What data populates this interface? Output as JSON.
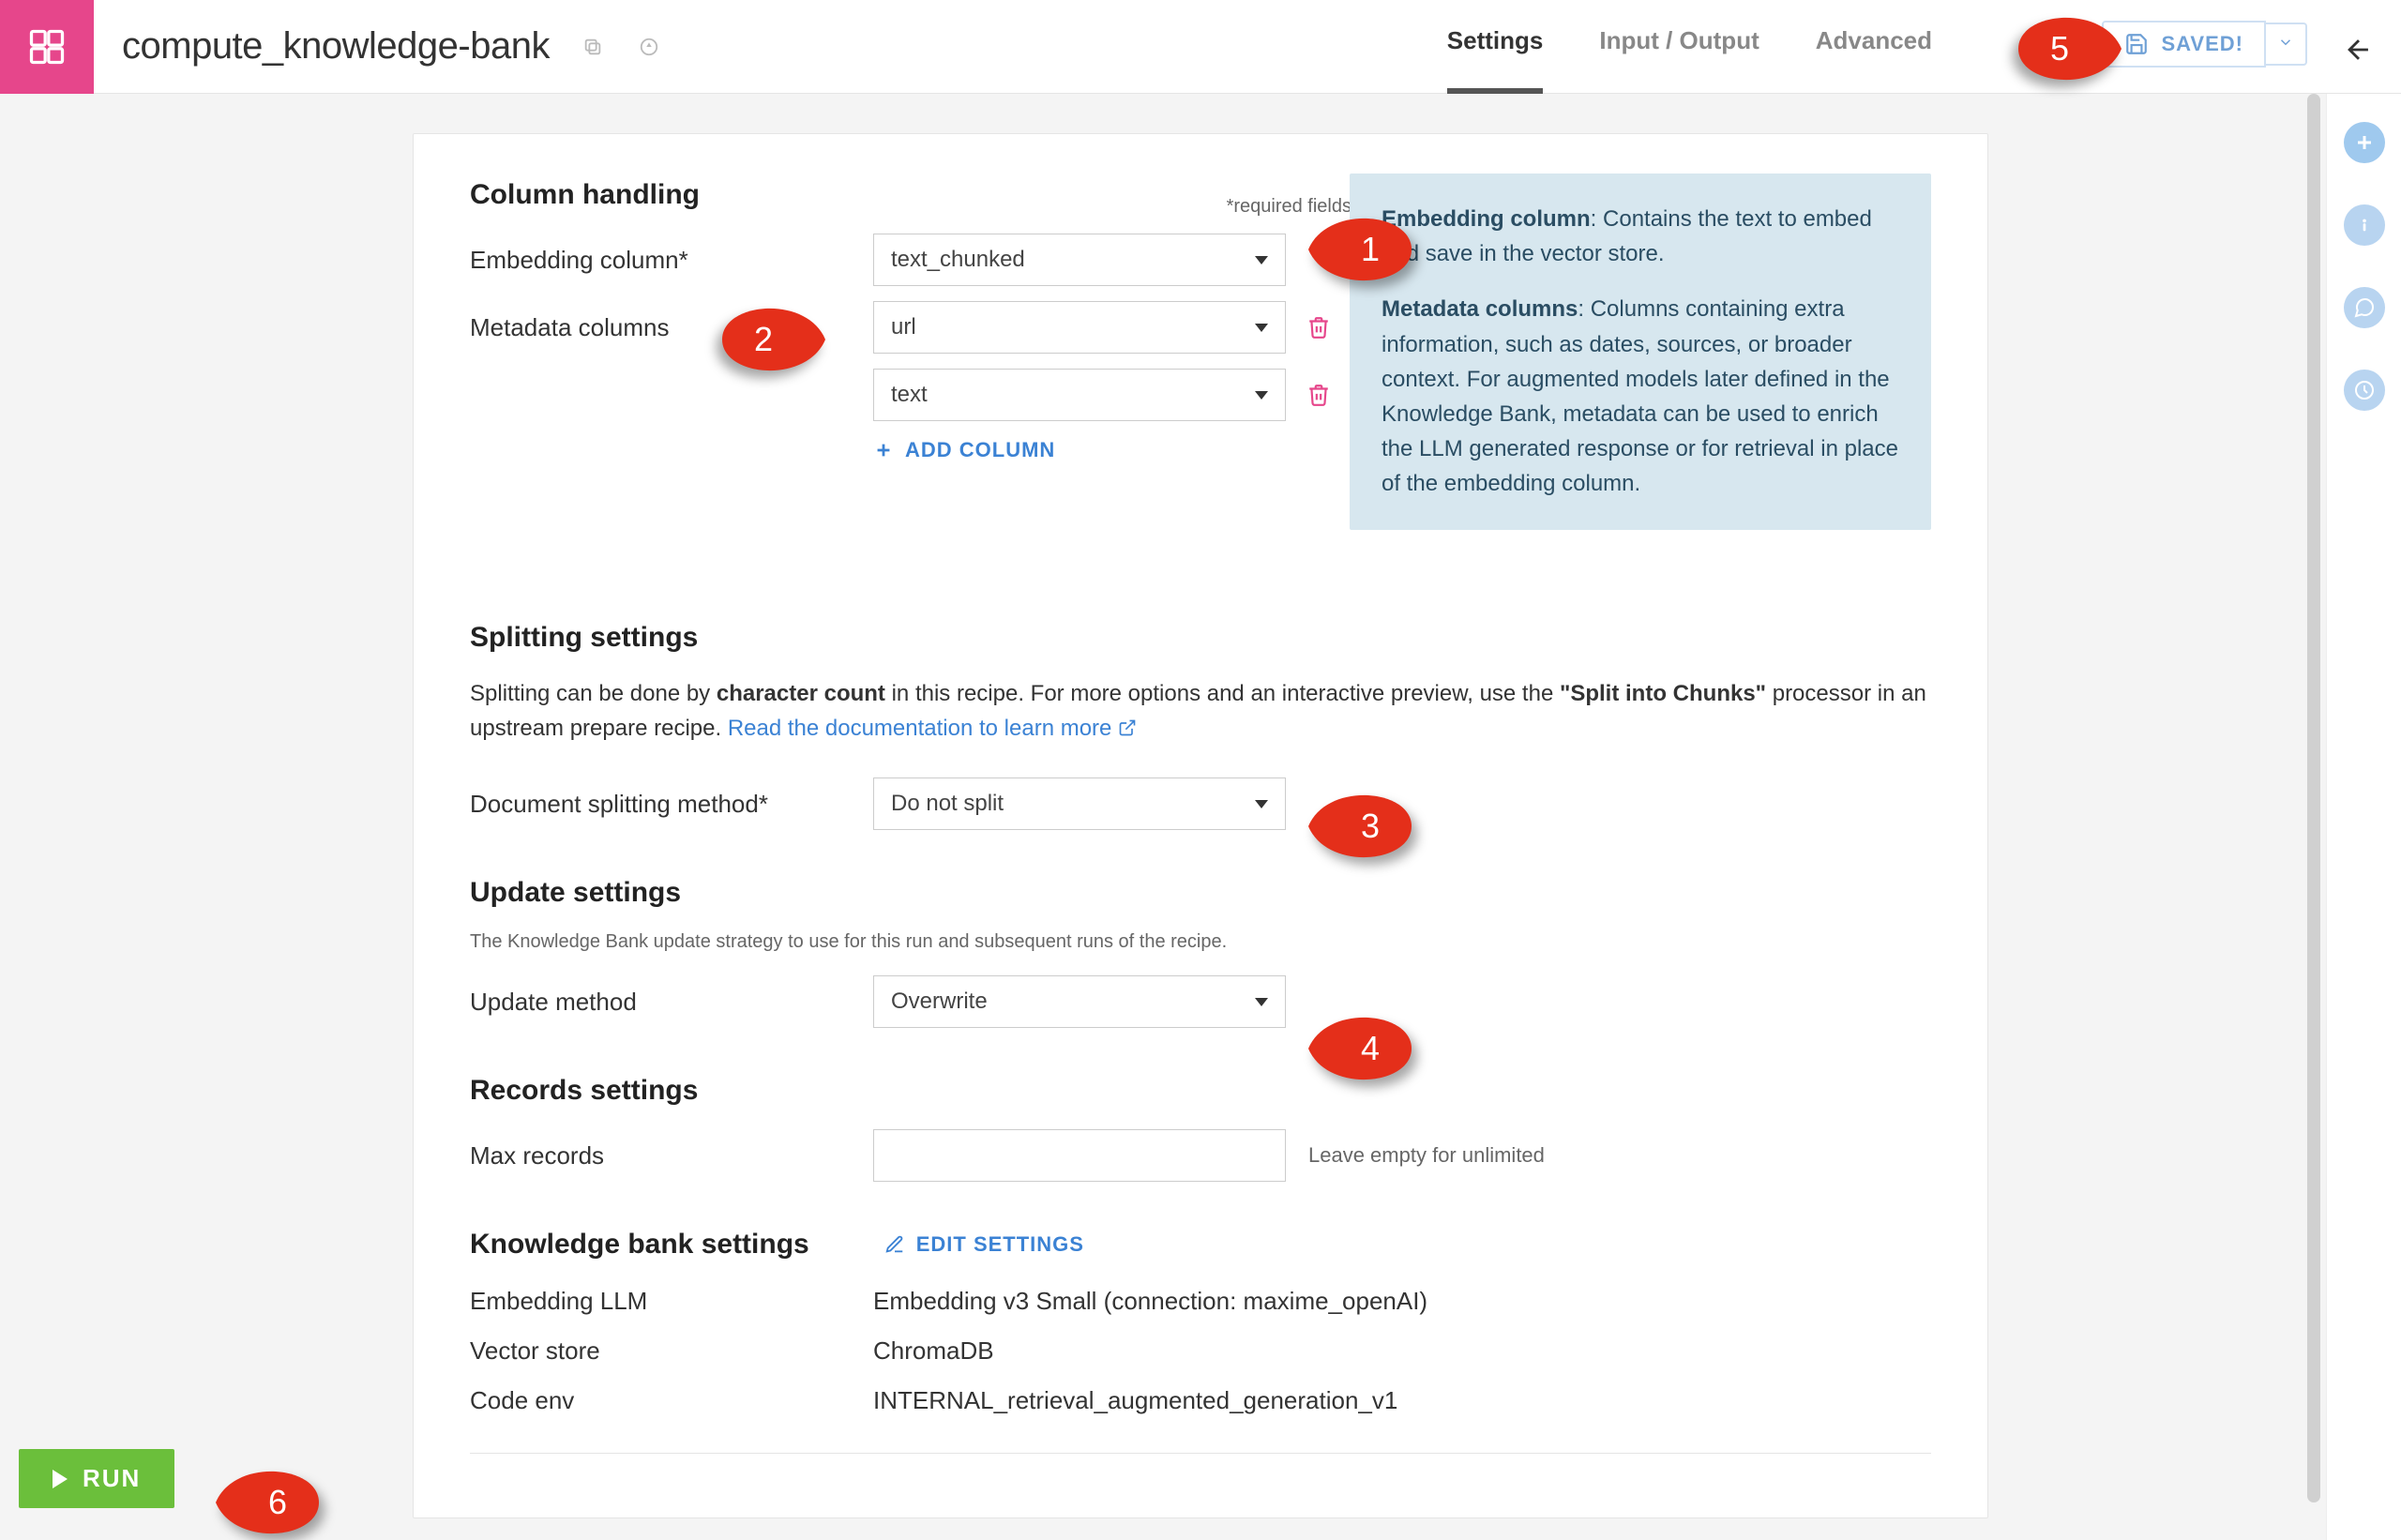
{
  "header": {
    "title": "compute_knowledge-bank",
    "tabs": {
      "settings": "Settings",
      "io": "Input / Output",
      "advanced": "Advanced"
    },
    "saved_label": "SAVED!"
  },
  "column_handling": {
    "heading": "Column handling",
    "required_note": "*required fields",
    "embedding_label": "Embedding column*",
    "embedding_value": "text_chunked",
    "metadata_label": "Metadata columns",
    "metadata_values": [
      "url",
      "text"
    ],
    "add_column": "ADD COLUMN"
  },
  "info_box": {
    "p1a": "Embedding column",
    "p1b": ": Contains the text to embed and save in the vector store.",
    "p2a": "Metadata columns",
    "p2b": ": Columns containing extra information, such as dates, sources, or broader context. For augmented models later defined in the Knowledge Bank, metadata can be used to enrich the LLM generated response or for retrieval in place of the embedding column."
  },
  "splitting": {
    "heading": "Splitting settings",
    "desc_prefix": "Splitting can be done by ",
    "desc_bold1": "character count",
    "desc_mid": " in this recipe. For more options and an interactive preview, use the ",
    "desc_bold2": "\"Split into Chunks\"",
    "desc_suffix": " processor in an upstream prepare recipe. ",
    "doc_link": "Read the documentation to learn more",
    "method_label": "Document splitting method*",
    "method_value": "Do not split"
  },
  "update": {
    "heading": "Update settings",
    "micro": "The Knowledge Bank update strategy to use for this run and subsequent runs of the recipe.",
    "method_label": "Update method",
    "method_value": "Overwrite"
  },
  "records": {
    "heading": "Records settings",
    "label": "Max records",
    "hint": "Leave empty for unlimited",
    "value": ""
  },
  "kb": {
    "heading": "Knowledge bank settings",
    "edit": "EDIT SETTINGS",
    "rows": {
      "llm_label": "Embedding LLM",
      "llm_value": "Embedding v3 Small (connection: maxime_openAI)",
      "vs_label": "Vector store",
      "vs_value": "ChromaDB",
      "env_label": "Code env",
      "env_value": "INTERNAL_retrieval_augmented_generation_v1"
    }
  },
  "run_label": "RUN",
  "callouts": {
    "c1": "1",
    "c2": "2",
    "c3": "3",
    "c4": "4",
    "c5": "5",
    "c6": "6"
  }
}
